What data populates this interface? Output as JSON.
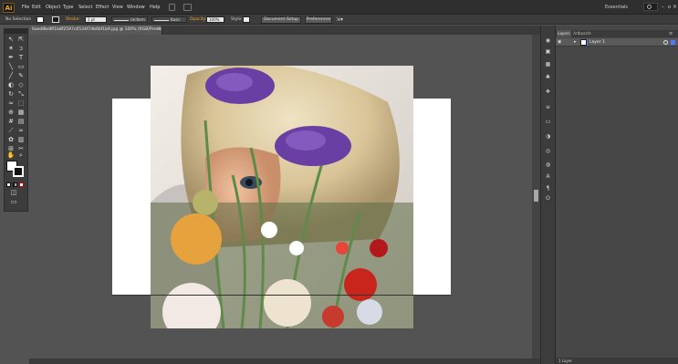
{
  "app": {
    "logo": "Ai",
    "workspace": "Essentials"
  },
  "menu": {
    "items": [
      "File",
      "Edit",
      "Object",
      "Type",
      "Select",
      "Effect",
      "View",
      "Window",
      "Help"
    ]
  },
  "control_bar": {
    "selection_label": "No Selection",
    "stroke_label": "Stroke:",
    "stroke_weight": "1 pt",
    "profile_label": "Uniform",
    "brush_label": "Basic",
    "opacity_label": "Opacity:",
    "opacity_value": "100%",
    "style_label": "Style:",
    "document_setup": "Document Setup",
    "preferences": "Preferences"
  },
  "document": {
    "tab_title": "6aed8bd8f1b8f2597c6534f7db6bf1b9.jpg @ 100% (RGB/Preview)",
    "tab_close": "×"
  },
  "layers_panel": {
    "tabs": [
      "Layers",
      "Artboards"
    ],
    "layer_name": "Layer 1",
    "footer": "1 Layer"
  },
  "colors": {
    "interface": "#535353",
    "panel": "#474747",
    "accent": "#f3a533",
    "layer_color": "#4a7bff"
  },
  "icons": {
    "tools": [
      "selection-tool-icon",
      "direct-selection-tool-icon",
      "magic-wand-icon",
      "lasso-icon",
      "pen-tool-icon",
      "type-tool-icon",
      "line-tool-icon",
      "rectangle-tool-icon",
      "paintbrush-icon",
      "pencil-icon",
      "blob-brush-icon",
      "eraser-icon",
      "rotate-icon",
      "scale-icon",
      "width-tool-icon",
      "free-transform-icon",
      "shape-builder-icon",
      "perspective-grid-icon",
      "mesh-icon",
      "gradient-icon",
      "eyedropper-icon",
      "blend-icon",
      "symbol-sprayer-icon",
      "column-graph-icon",
      "artboard-tool-icon",
      "slice-icon",
      "hand-tool-icon",
      "zoom-tool-icon"
    ]
  }
}
